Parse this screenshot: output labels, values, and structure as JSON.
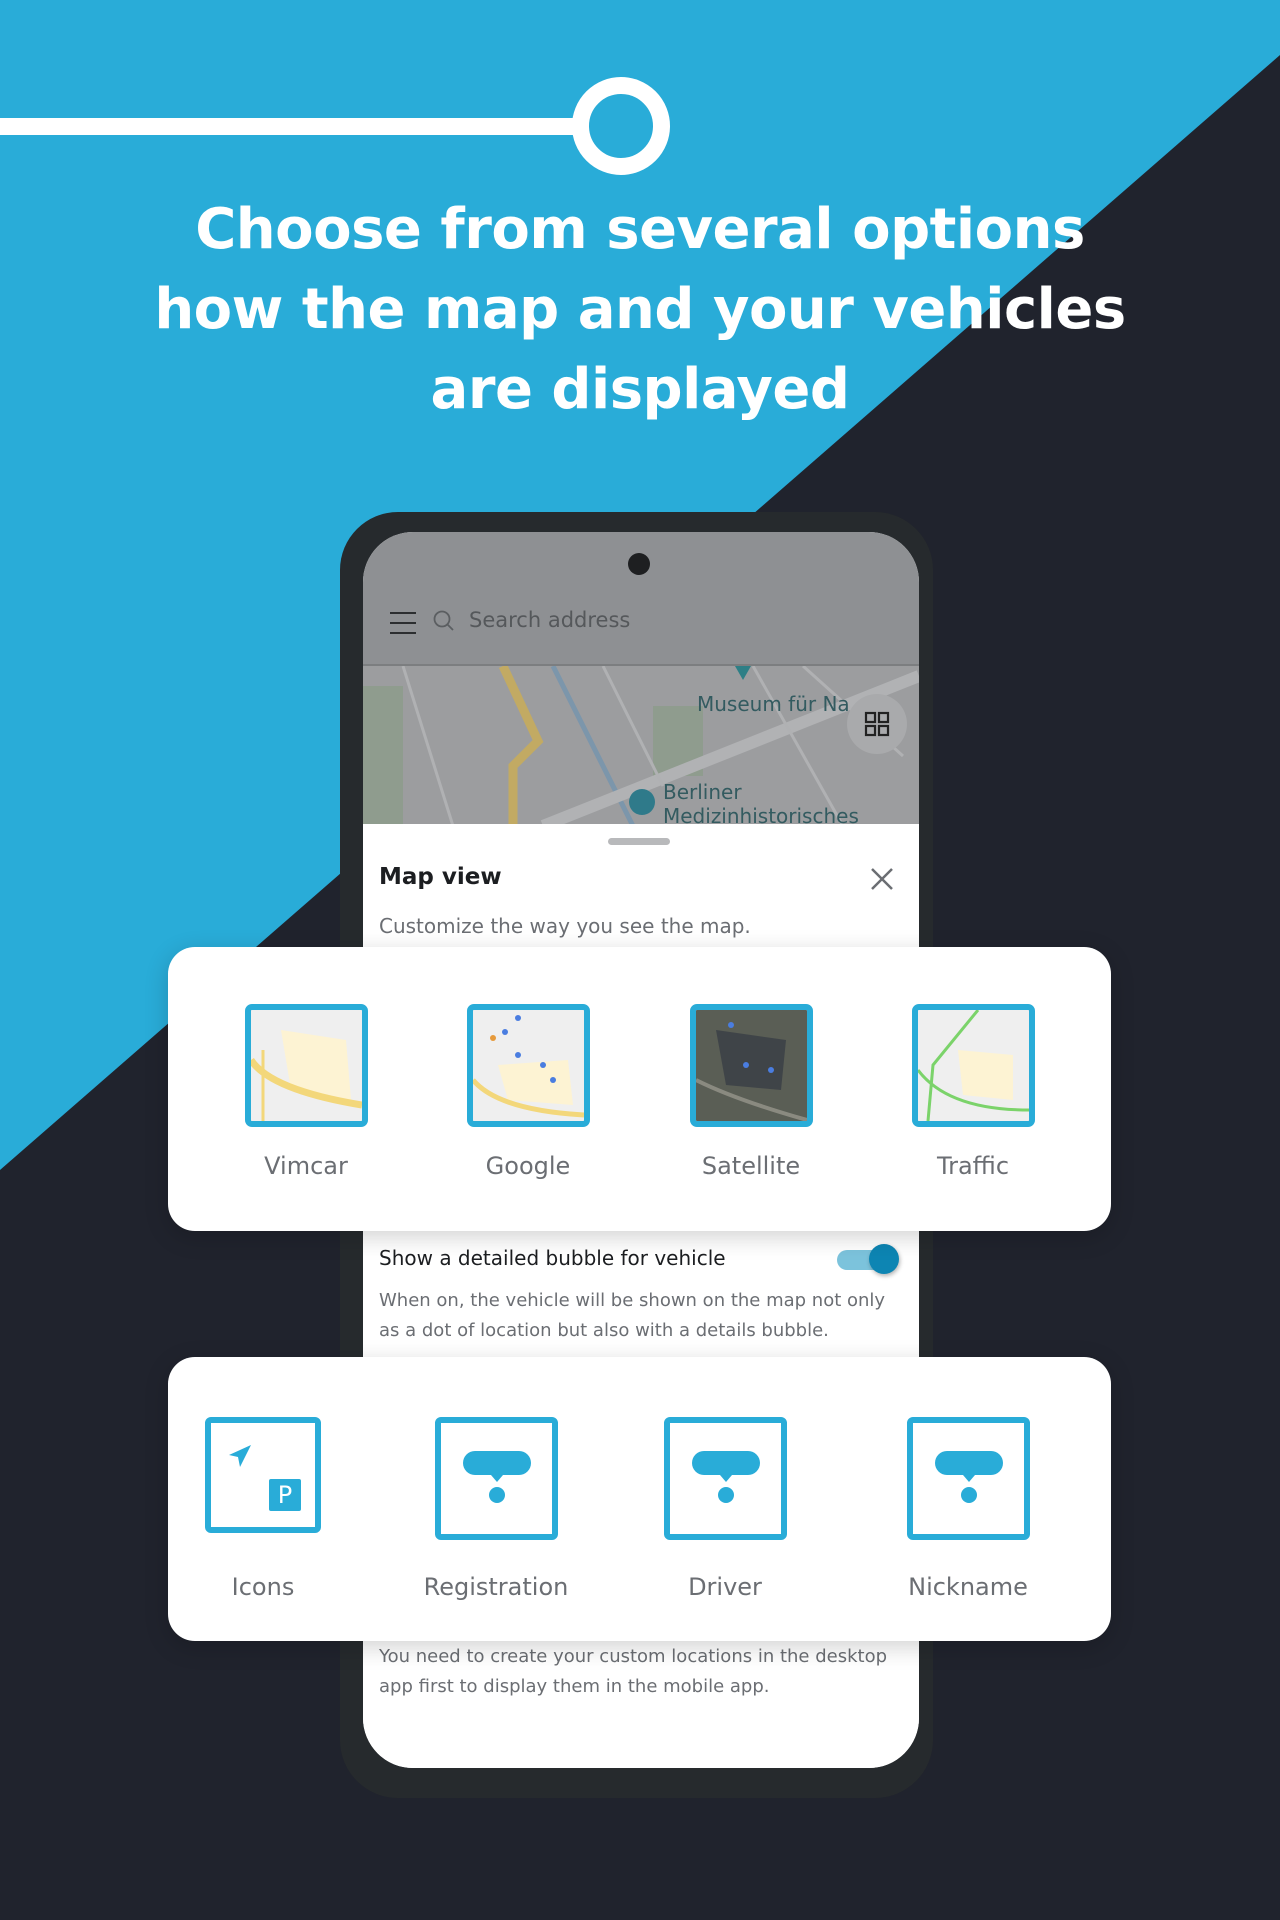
{
  "headline": [
    "Choose from several options",
    "how the map and your vehicles",
    "are displayed"
  ],
  "colors": {
    "brand_blue": "#29acd8",
    "dark_bg": "#20232d",
    "toggle_on": "#0d85b3"
  },
  "app": {
    "search": {
      "placeholder": "Search address",
      "icon": "search-icon"
    },
    "menu_icon": "hamburger-icon",
    "map": {
      "labels": [
        "Museum für Na",
        "Berliner",
        "Medizinhistorisches"
      ],
      "layers_button_icon": "grid-icon"
    },
    "sheet": {
      "title": "Map view",
      "subtitle": "Customize the way you see the map.",
      "close_icon": "close-icon",
      "map_styles": [
        {
          "label": "Vimcar"
        },
        {
          "label": "Google"
        },
        {
          "label": "Satellite"
        },
        {
          "label": "Traffic"
        }
      ],
      "bubble_toggle": {
        "label": "Show a detailed bubble for vehicle",
        "on": true,
        "description": "When on, the vehicle will be shown on the map not only as a dot of location but also with a details bubble."
      },
      "vehicle_display": [
        {
          "label": "Icons",
          "icon": "icons-icon"
        },
        {
          "label": "Registration",
          "icon": "bubble-icon"
        },
        {
          "label": "Driver",
          "icon": "bubble-icon"
        },
        {
          "label": "Nickname",
          "icon": "bubble-icon"
        }
      ],
      "custom_locations_note": "You need to create your custom locations in the desktop app first to display them in the mobile app."
    }
  }
}
